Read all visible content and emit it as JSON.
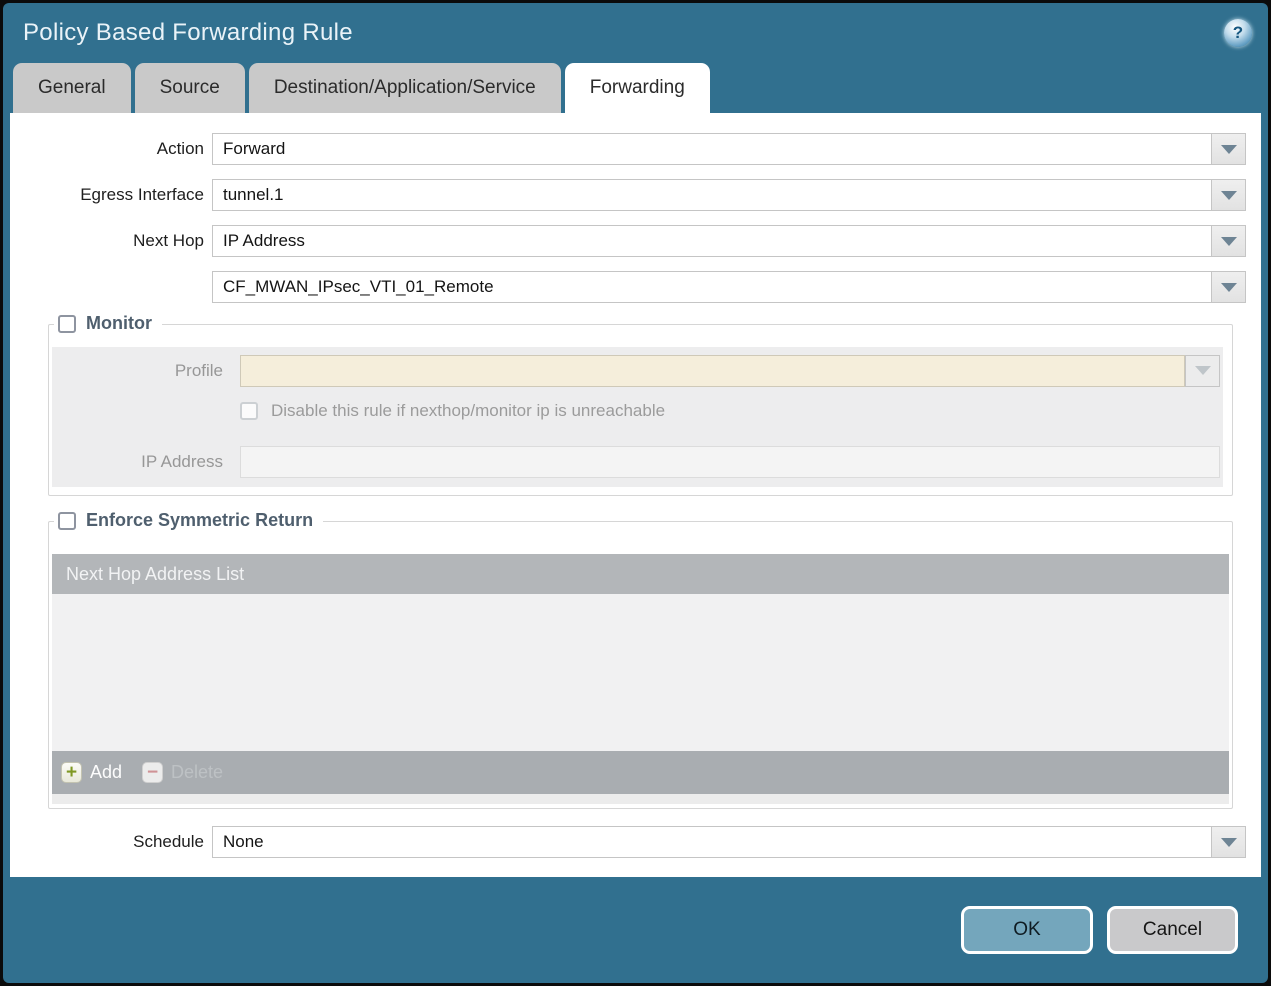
{
  "window": {
    "title": "Policy Based Forwarding Rule"
  },
  "icons": {
    "help": "?",
    "add": "+",
    "delete": "−"
  },
  "tabs": [
    {
      "label": "General",
      "active": false
    },
    {
      "label": "Source",
      "active": false
    },
    {
      "label": "Destination/Application/Service",
      "active": false
    },
    {
      "label": "Forwarding",
      "active": true
    }
  ],
  "form": {
    "action": {
      "label": "Action",
      "value": "Forward"
    },
    "egress_interface": {
      "label": "Egress Interface",
      "value": "tunnel.1"
    },
    "next_hop": {
      "label": "Next Hop",
      "value": "IP Address"
    },
    "next_hop_address": {
      "value": "CF_MWAN_IPsec_VTI_01_Remote"
    },
    "schedule": {
      "label": "Schedule",
      "value": "None"
    }
  },
  "monitor": {
    "legend": "Monitor",
    "checked": false,
    "profile": {
      "label": "Profile",
      "value": ""
    },
    "disable_rule": {
      "label": "Disable this rule if nexthop/monitor ip is unreachable",
      "checked": false
    },
    "ip_address": {
      "label": "IP Address",
      "value": ""
    }
  },
  "symmetric_return": {
    "legend": "Enforce Symmetric Return",
    "checked": false,
    "table": {
      "header": "Next Hop Address List",
      "rows": []
    },
    "add_label": "Add",
    "delete_label": "Delete"
  },
  "footer": {
    "ok_label": "OK",
    "cancel_label": "Cancel"
  },
  "colors": {
    "titlebar": "#31708f",
    "accent_ok": "#74a6bc",
    "tab_inactive": "#c9c9c9",
    "legend_text": "#4f5f6e",
    "section_bg": "#ededee",
    "disabled_field": "#f5eedb",
    "table_header": "#b3b6b9",
    "table_footer": "#a9adb1",
    "add_icon_green": "#7f9824",
    "delete_icon_red": "#cf9296"
  }
}
